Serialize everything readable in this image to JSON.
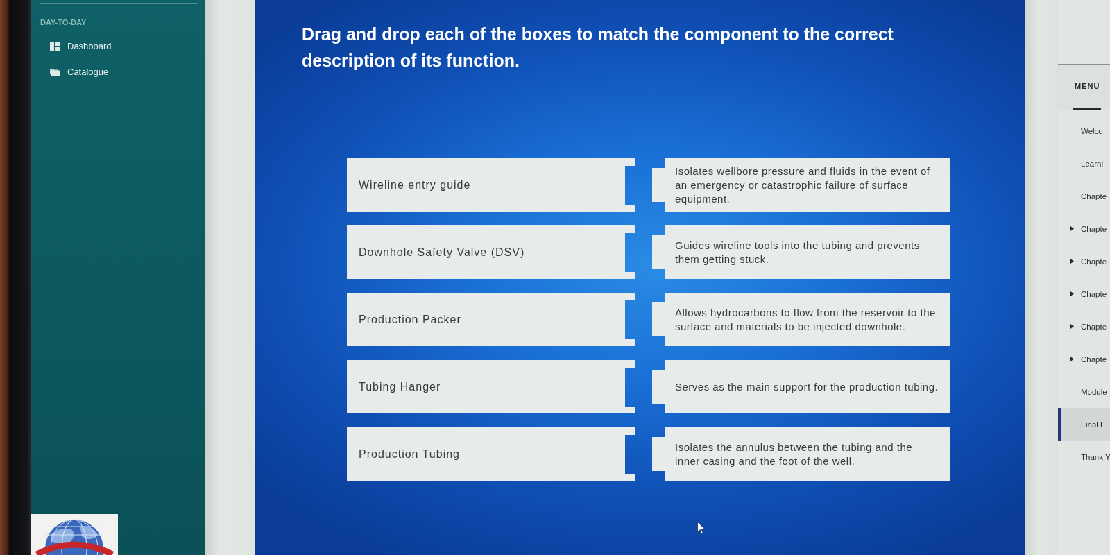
{
  "sidebar": {
    "section_title": "DAY-TO-DAY",
    "items": [
      {
        "label": "Dashboard"
      },
      {
        "label": "Catalogue"
      }
    ]
  },
  "activity": {
    "instruction": "Drag and drop each of the boxes to match the component to the correct description of its function.",
    "pairs": [
      {
        "component": "Wireline entry guide",
        "description": "Isolates wellbore pressure and fluids in the event of an emergency or catastrophic failure of surface equipment."
      },
      {
        "component": "Downhole Safety Valve (DSV)",
        "description": "Guides wireline tools into the tubing and prevents them getting stuck."
      },
      {
        "component": "Production Packer",
        "description": "Allows hydrocarbons to flow from the reservoir to the surface and materials to be injected downhole."
      },
      {
        "component": "Tubing Hanger",
        "description": "Serves as the main support for the production tubing."
      },
      {
        "component": "Production Tubing",
        "description": "Isolates the annulus between the tubing and the inner casing and the foot of the well."
      }
    ]
  },
  "course_menu": {
    "tabs": [
      {
        "label": "MENU",
        "selected": true
      }
    ],
    "items": [
      {
        "label": "Welco",
        "kind": "page",
        "selected": false
      },
      {
        "label": "Learni",
        "kind": "page",
        "selected": false
      },
      {
        "label": "Chapte",
        "kind": "page",
        "selected": false
      },
      {
        "label": "Chapte",
        "kind": "section",
        "selected": false
      },
      {
        "label": "Chapte",
        "kind": "section",
        "selected": false
      },
      {
        "label": "Chapte",
        "kind": "section",
        "selected": false
      },
      {
        "label": "Chapte",
        "kind": "section",
        "selected": false
      },
      {
        "label": "Chapte",
        "kind": "section",
        "selected": false
      },
      {
        "label": "Module",
        "kind": "page",
        "selected": false
      },
      {
        "label": "Final E",
        "kind": "page",
        "selected": true
      },
      {
        "label": "Thank Y",
        "kind": "page",
        "selected": false
      }
    ]
  }
}
